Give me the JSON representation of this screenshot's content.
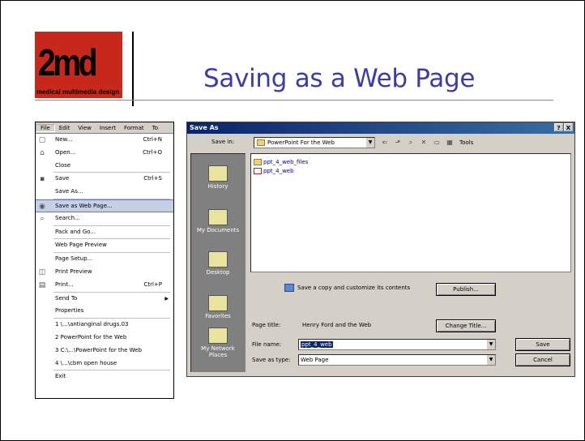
{
  "logo": {
    "big": "2md",
    "small": "medical multimedia design"
  },
  "slide": {
    "title": "Saving as a Web Page"
  },
  "menu": {
    "bar": [
      "File",
      "Edit",
      "View",
      "Insert",
      "Format",
      "To"
    ],
    "items": [
      {
        "label": "New...",
        "shortcut": "Ctrl+N",
        "icon": "new-doc-icon",
        "glyph": "▢"
      },
      {
        "label": "Open...",
        "shortcut": "Ctrl+O",
        "icon": "open-folder-icon",
        "glyph": "⌂"
      },
      {
        "label": "Close",
        "shortcut": "",
        "icon": "",
        "glyph": ""
      },
      {
        "label": "Save",
        "shortcut": "Ctrl+S",
        "icon": "floppy-disk-icon",
        "glyph": "▪"
      },
      {
        "label": "Save As...",
        "shortcut": "",
        "icon": "",
        "glyph": ""
      },
      {
        "label": "Save as Web Page...",
        "shortcut": "",
        "icon": "web-save-icon",
        "glyph": "◉",
        "highlight": true
      },
      {
        "label": "Search...",
        "shortcut": "",
        "icon": "search-icon",
        "glyph": "⌕"
      },
      {
        "label": "Pack and Go...",
        "shortcut": "",
        "icon": "",
        "glyph": ""
      },
      {
        "label": "Web Page Preview",
        "shortcut": "",
        "icon": "",
        "glyph": ""
      },
      {
        "label": "Page Setup...",
        "shortcut": "",
        "icon": "",
        "glyph": ""
      },
      {
        "label": "Print Preview",
        "shortcut": "",
        "icon": "print-preview-icon",
        "glyph": "◫"
      },
      {
        "label": "Print...",
        "shortcut": "Ctrl+P",
        "icon": "printer-icon",
        "glyph": "▤"
      },
      {
        "label": "Send To",
        "shortcut": "",
        "icon": "",
        "glyph": "",
        "submenu": true
      },
      {
        "label": "Properties",
        "shortcut": "",
        "icon": "",
        "glyph": ""
      },
      {
        "label": "1 \\...\\antianginal drugs.03",
        "shortcut": "",
        "icon": "",
        "glyph": ""
      },
      {
        "label": "2 PowerPoint for the Web",
        "shortcut": "",
        "icon": "",
        "glyph": ""
      },
      {
        "label": "3 C:\\...\\PowerPoint for the Web",
        "shortcut": "",
        "icon": "",
        "glyph": ""
      },
      {
        "label": "4 \\...\\cbm open house",
        "shortcut": "",
        "icon": "",
        "glyph": ""
      },
      {
        "label": "Exit",
        "shortcut": "",
        "icon": "",
        "glyph": ""
      }
    ]
  },
  "dialog": {
    "title": "Save As",
    "help_btn": "?",
    "close_btn": "X",
    "save_in_label": "Save in:",
    "save_in_value": "PowerPoint For the Web",
    "tools_label": "Tools",
    "places": [
      "History",
      "My Documents",
      "Desktop",
      "Favorites",
      "My Network Places"
    ],
    "files": [
      "ppt_4_web_files",
      "ppt_4_web"
    ],
    "copy_text": "Save a copy and customize its contents",
    "publish_btn": "Publish...",
    "page_title_label": "Page title:",
    "page_title_value": "Henry Ford and the Web",
    "change_title_btn": "Change Title...",
    "file_name_label": "File name:",
    "file_name_value": "ppt_4_web",
    "save_type_label": "Save as type:",
    "save_type_value": "Web Page",
    "save_btn": "Save",
    "cancel_btn": "Cancel"
  }
}
